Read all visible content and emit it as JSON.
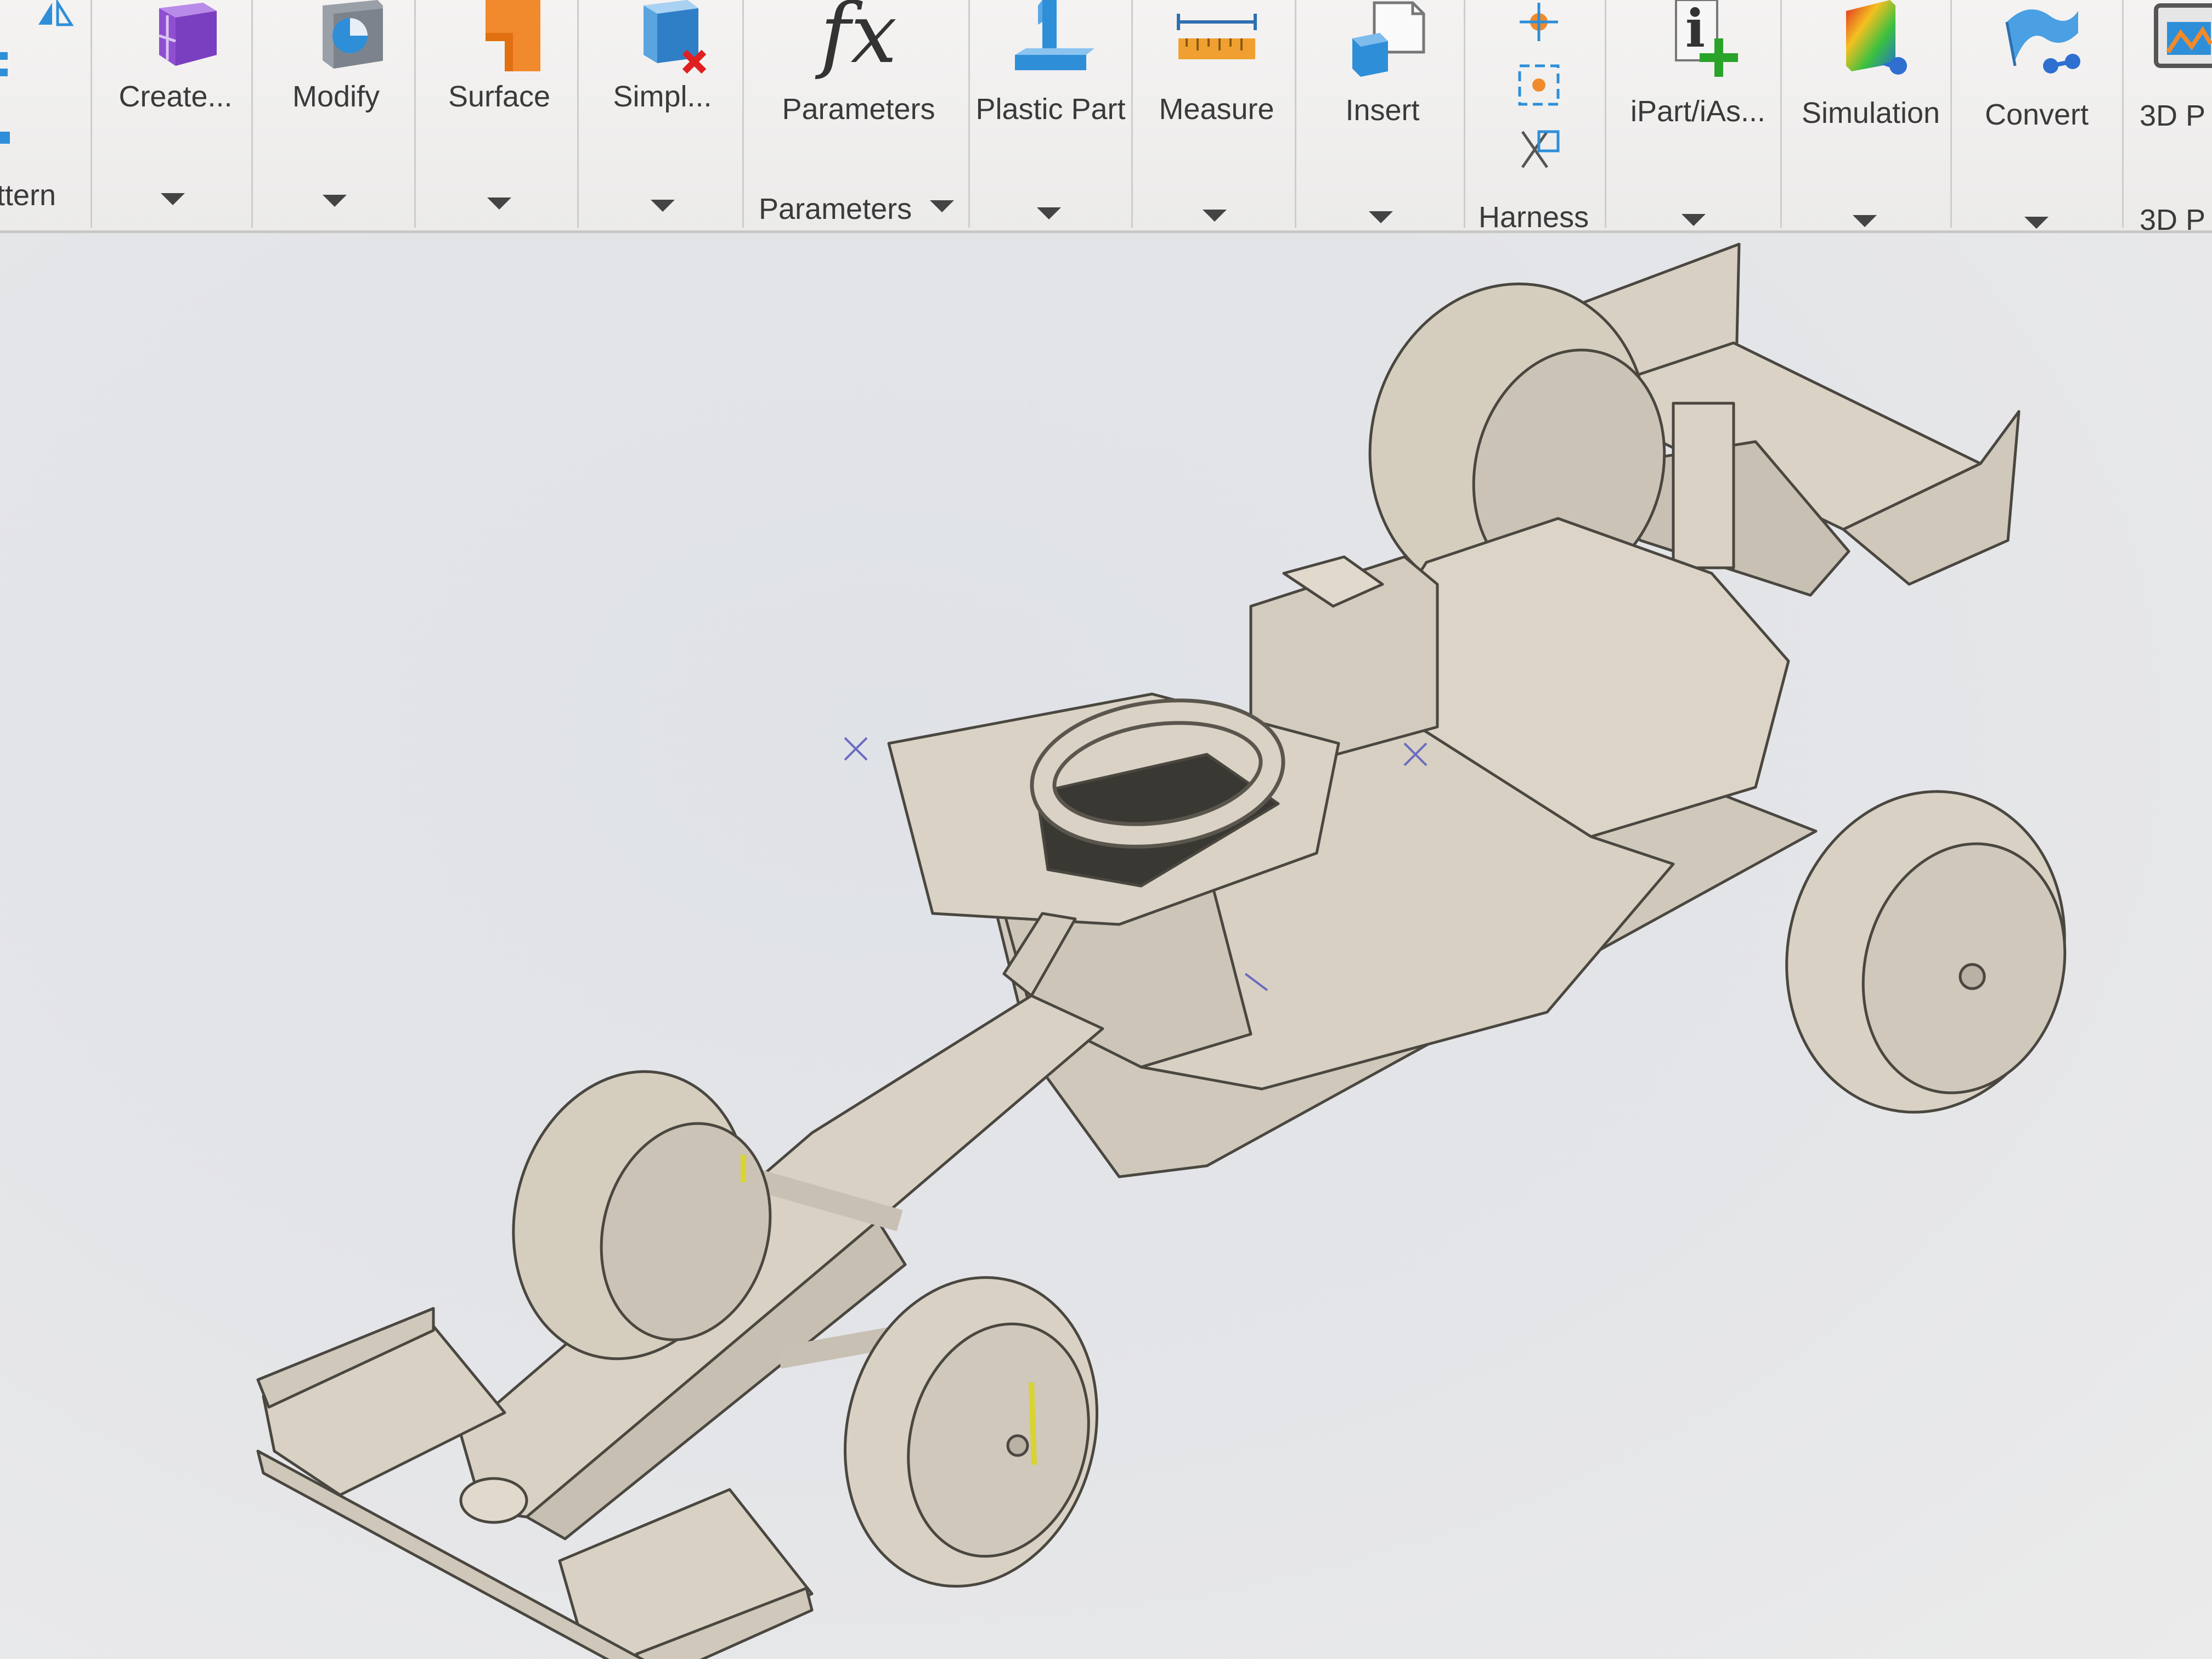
{
  "ribbon": {
    "pattern_group_label": "ttern",
    "buttons": [
      {
        "id": "create",
        "label": "Create...",
        "icon": "create-block-icon"
      },
      {
        "id": "modify",
        "label": "Modify",
        "icon": "modify-icon"
      },
      {
        "id": "surface",
        "label": "Surface",
        "icon": "surface-icon"
      },
      {
        "id": "simplify",
        "label": "Simpl...",
        "icon": "simplify-icon"
      },
      {
        "id": "parameters",
        "label": "Parameters",
        "icon": "fx-icon"
      },
      {
        "id": "plastic-part",
        "label": "Plastic Part",
        "icon": "plastic-part-icon"
      },
      {
        "id": "measure",
        "label": "Measure",
        "icon": "measure-ruler-icon"
      },
      {
        "id": "insert",
        "label": "Insert",
        "icon": "insert-icon"
      },
      {
        "id": "ipart",
        "label": "iPart/iAs...",
        "icon": "ipart-icon"
      },
      {
        "id": "simulation",
        "label": "Simulation",
        "icon": "simulation-icon"
      },
      {
        "id": "convert",
        "label": "Convert",
        "icon": "convert-icon"
      },
      {
        "id": "3dp",
        "label": "3D P",
        "icon": "3d-print-icon"
      }
    ],
    "parameters_group_label": "Parameters",
    "harness_group_label": "Harness",
    "3dp_group_label": "3D P",
    "fx_glyph": "fx"
  },
  "colors": {
    "ribbon_bg": "#f1f0ef",
    "viewport_bg": "#e4e5e8",
    "model_fill": "#dcd5c8",
    "model_edge": "#4a4740",
    "accent_purple": "#9b59d6",
    "accent_orange": "#f08a2c",
    "accent_blue": "#2e8fd8"
  }
}
